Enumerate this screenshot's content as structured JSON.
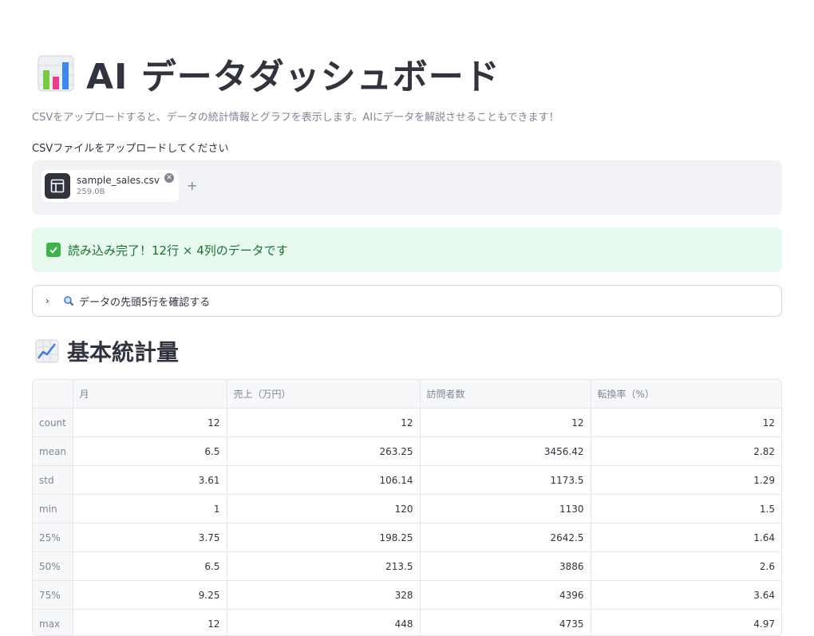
{
  "header": {
    "title_icon": "bar-chart-icon",
    "title": "AI データダッシュボード",
    "caption": "CSVをアップロードすると、データの統計情報とグラフを表示します。AIにデータを解説させることもできます！"
  },
  "uploader": {
    "label": "CSVファイルをアップロードしてください",
    "file_name": "sample_sales.csv",
    "file_size": "259.0B",
    "add_label": "+"
  },
  "success": {
    "icon": "check-box-icon",
    "message": "読み込み完了！12行 × 4列のデータです",
    "color": "#177233",
    "background": "#e8f9ee"
  },
  "expander": {
    "icon": "magnifier-icon",
    "label": "データの先頭5行を確認する"
  },
  "stats": {
    "icon": "line-chart-icon",
    "heading": "基本統計量",
    "columns": [
      "",
      "月",
      "売上（万円）",
      "訪問者数",
      "転換率（%）"
    ],
    "rows": [
      [
        "count",
        "12",
        "12",
        "12",
        "12"
      ],
      [
        "mean",
        "6.5",
        "263.25",
        "3456.42",
        "2.82"
      ],
      [
        "std",
        "3.61",
        "106.14",
        "1173.5",
        "1.29"
      ],
      [
        "min",
        "1",
        "120",
        "1130",
        "1.5"
      ],
      [
        "25%",
        "3.75",
        "198.25",
        "2642.5",
        "1.64"
      ],
      [
        "50%",
        "6.5",
        "213.5",
        "3886",
        "2.6"
      ],
      [
        "75%",
        "9.25",
        "328",
        "4396",
        "3.64"
      ],
      [
        "max",
        "12",
        "448",
        "4735",
        "4.97"
      ]
    ]
  }
}
